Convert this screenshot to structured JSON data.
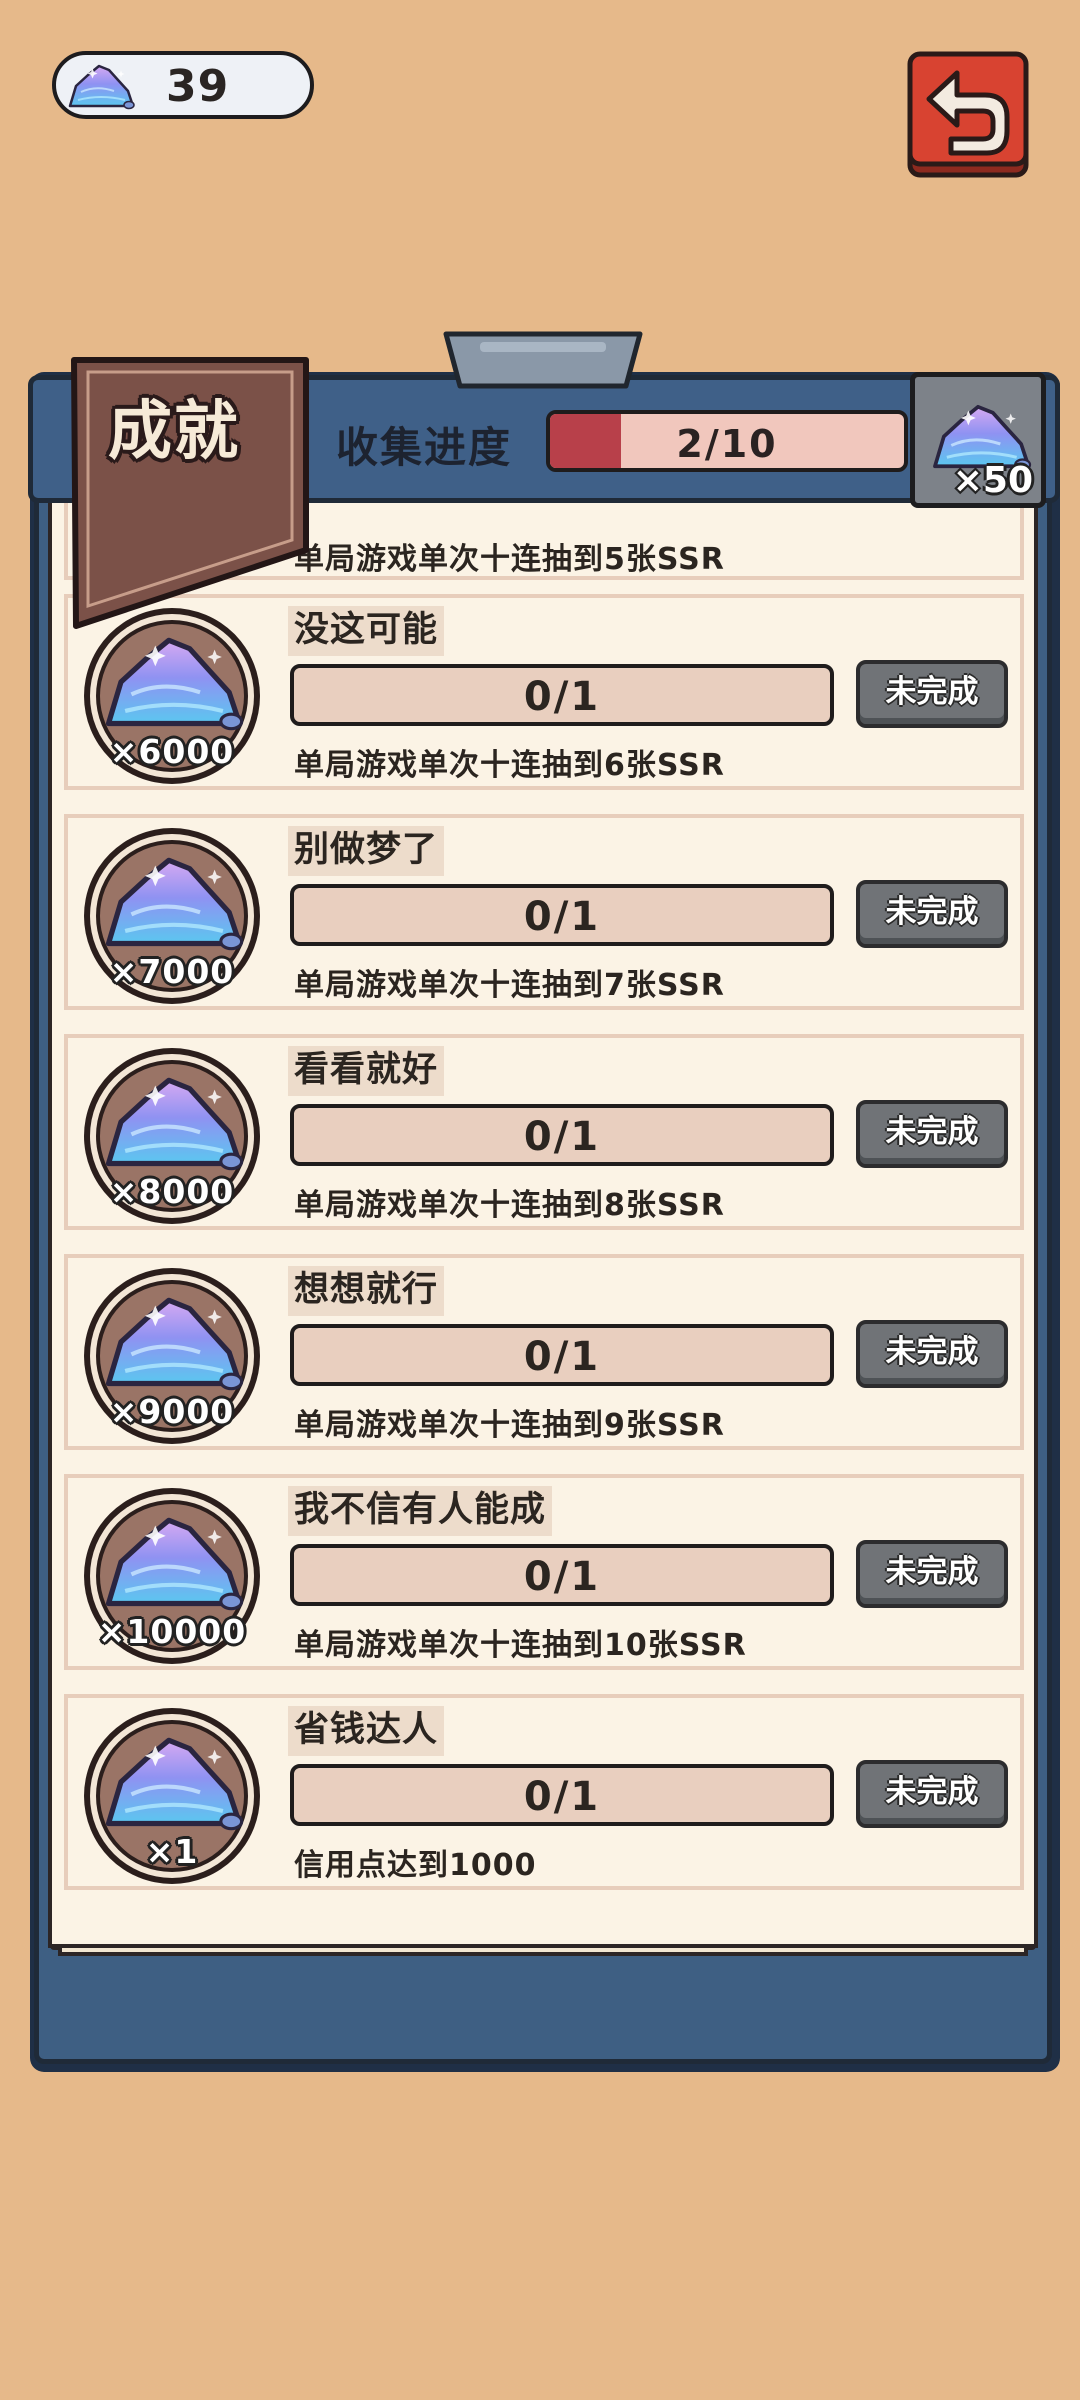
{
  "currency": {
    "icon": "crystal-gem-icon",
    "value": "39"
  },
  "back_button": {
    "icon": "back-arrow-icon"
  },
  "header": {
    "title": "成就",
    "progress_label": "收集进度",
    "progress_text": "2/10",
    "progress_fraction": 0.2,
    "reward_qty": "×50"
  },
  "partial_item": {
    "description": "单局游戏单次十连抽到5张SSR"
  },
  "achievements": [
    {
      "name": "没这可能",
      "reward": "×6000",
      "progress": "0/1",
      "status": "未完成",
      "description": "单局游戏单次十连抽到6张SSR"
    },
    {
      "name": "别做梦了",
      "reward": "×7000",
      "progress": "0/1",
      "status": "未完成",
      "description": "单局游戏单次十连抽到7张SSR"
    },
    {
      "name": "看看就好",
      "reward": "×8000",
      "progress": "0/1",
      "status": "未完成",
      "description": "单局游戏单次十连抽到8张SSR"
    },
    {
      "name": "想想就行",
      "reward": "×9000",
      "progress": "0/1",
      "status": "未完成",
      "description": "单局游戏单次十连抽到9张SSR"
    },
    {
      "name": "我不信有人能成",
      "reward": "×10000",
      "progress": "0/1",
      "status": "未完成",
      "description": "单局游戏单次十连抽到10张SSR"
    },
    {
      "name": "省钱达人",
      "reward": "×1",
      "progress": "0/1",
      "status": "未完成",
      "description": "信用点达到1000"
    }
  ],
  "colors": {
    "background": "#e6b98a",
    "board": "#3e5f83",
    "paper": "#fbf3e5",
    "progress_fill": "#b8404a",
    "button_gray": "#707377"
  }
}
